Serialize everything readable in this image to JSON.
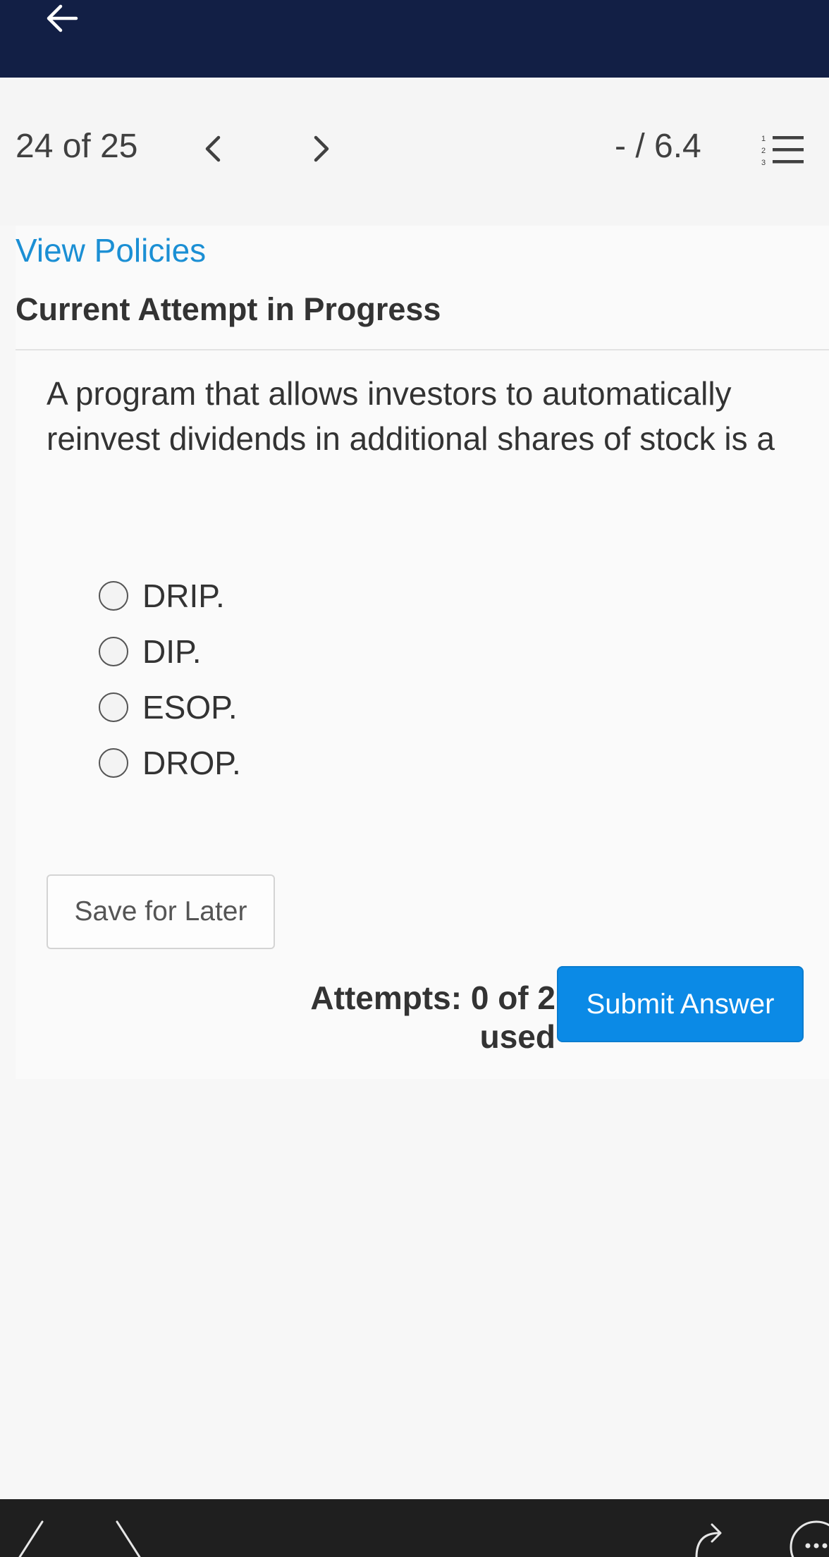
{
  "header": {
    "back_icon": "arrow-left-icon",
    "bg_color": "#121f45"
  },
  "nav": {
    "counter": "24 of 25",
    "prev_icon": "chevron-left-icon",
    "next_icon": "chevron-right-icon",
    "score": "- / 6.4",
    "list_icon": "numbered-list-icon"
  },
  "main": {
    "view_policies": "View Policies",
    "heading": "Current Attempt in Progress",
    "question": "A program that allows investors to automatically reinvest dividends in additional shares of stock is a",
    "options": [
      {
        "label": "DRIP."
      },
      {
        "label": "DIP."
      },
      {
        "label": "ESOP."
      },
      {
        "label": "DROP."
      }
    ],
    "save_label": "Save for Later",
    "attempts": "Attempts: 0 of 2 used",
    "submit_label": "Submit Answer",
    "accent_color": "#0b8ae6",
    "link_color": "#1b8fd4"
  },
  "bottom_bar": {
    "icons": [
      "undo-icon",
      "redo-icon",
      "share-icon",
      "more-icon"
    ]
  }
}
